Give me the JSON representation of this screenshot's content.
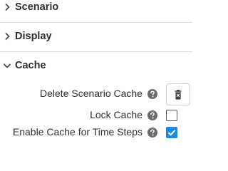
{
  "sections": [
    {
      "label": "Scenario",
      "expanded": false
    },
    {
      "label": "Display",
      "expanded": false
    },
    {
      "label": "Cache",
      "expanded": true
    }
  ],
  "cache": {
    "delete_label": "Delete Scenario Cache",
    "lock_label": "Lock Cache",
    "lock_checked": false,
    "enable_label": "Enable Cache for Time Steps",
    "enable_checked": true
  },
  "icons": {
    "collapsed": "chevron-right-icon",
    "expanded": "chevron-down-icon",
    "help": "help-circle-icon",
    "delete": "delete-forever-icon"
  },
  "colors": {
    "accent": "#1e88e5",
    "divider": "#dcdcdc",
    "help_icon": "#6b6b6b"
  }
}
